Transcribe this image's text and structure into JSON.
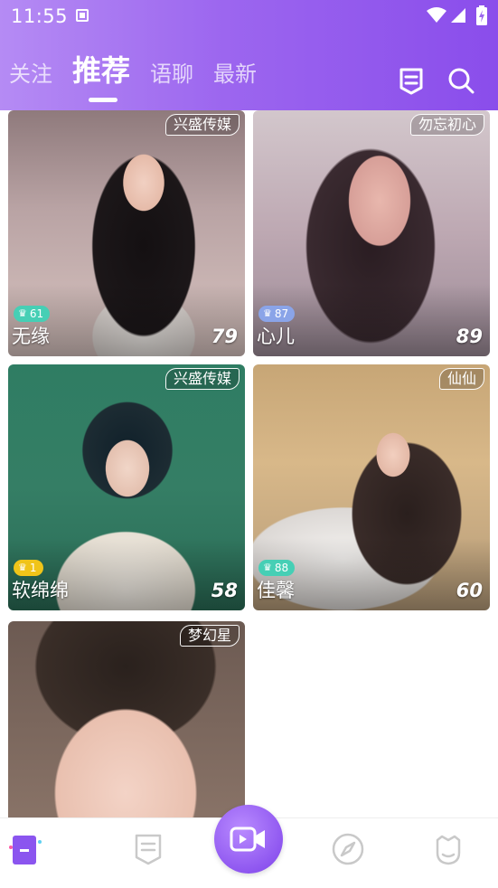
{
  "status_bar": {
    "time": "11:55"
  },
  "tabs": [
    {
      "label": "关注",
      "active": false
    },
    {
      "label": "推荐",
      "active": true
    },
    {
      "label": "语聊",
      "active": false
    },
    {
      "label": "最新",
      "active": false
    }
  ],
  "header_icons": [
    "ranking-badge-icon",
    "search-icon"
  ],
  "cards": [
    {
      "tag": "兴盛传媒",
      "level": "61",
      "level_color": "#46cfb5",
      "name": "无缘",
      "score": "79"
    },
    {
      "tag": "勿忘初心",
      "level": "87",
      "level_color": "#46cfb5",
      "name": "心儿",
      "score": "89"
    },
    {
      "tag": "兴盛传媒",
      "level": "1",
      "level_color": "#f0c419",
      "name": "软绵绵",
      "score": "58"
    },
    {
      "tag": "仙仙",
      "level": "88",
      "level_color": "#46cfb5",
      "name": "佳馨",
      "score": "60"
    },
    {
      "tag": "梦幻星",
      "level": "",
      "level_color": "",
      "name": "",
      "score": ""
    }
  ],
  "colors": {
    "header_start": "#b58bf4",
    "header_end": "#8a4deb",
    "accent": "#9a5cf0"
  },
  "bottom_nav": [
    "home-icon",
    "list-icon",
    "video-call-icon",
    "discover-compass-icon",
    "profile-icon"
  ]
}
